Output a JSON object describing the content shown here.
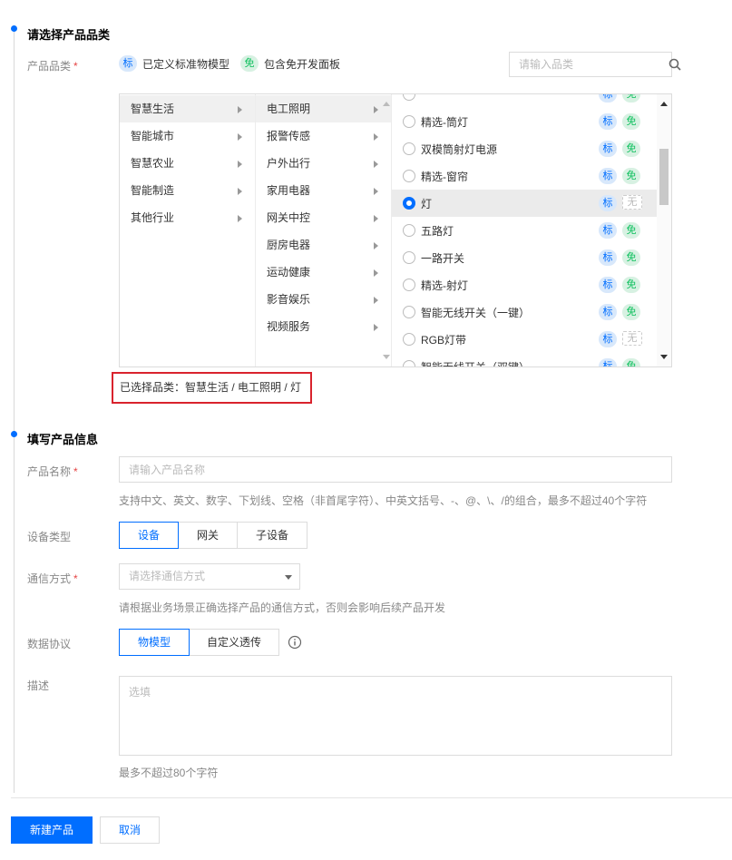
{
  "section1": {
    "title": "请选择产品品类"
  },
  "category": {
    "label": "产品品类",
    "required_mark": "*",
    "legend": {
      "biao_tag": "标",
      "biao_text": "已定义标准物模型",
      "mian_tag": "免",
      "mian_text": "包含免开发面板"
    },
    "search_placeholder": "请输入品类",
    "level1": [
      {
        "label": "智慧生活"
      },
      {
        "label": "智能城市"
      },
      {
        "label": "智慧农业"
      },
      {
        "label": "智能制造"
      },
      {
        "label": "其他行业"
      }
    ],
    "level2": [
      {
        "label": "电工照明"
      },
      {
        "label": "报警传感"
      },
      {
        "label": "户外出行"
      },
      {
        "label": "家用电器"
      },
      {
        "label": "网关中控"
      },
      {
        "label": "厨房电器"
      },
      {
        "label": "运动健康"
      },
      {
        "label": "影音娱乐"
      },
      {
        "label": "视频服务"
      }
    ],
    "level3": [
      {
        "label": "",
        "biao": "标",
        "mian": "免"
      },
      {
        "label": "精选-筒灯",
        "biao": "标",
        "mian": "免"
      },
      {
        "label": "双模筒射灯电源",
        "biao": "标",
        "mian": "免"
      },
      {
        "label": "精选-窗帘",
        "biao": "标",
        "mian": "免"
      },
      {
        "label": "灯",
        "biao": "标",
        "none": "无"
      },
      {
        "label": "五路灯",
        "biao": "标",
        "mian": "免"
      },
      {
        "label": "一路开关",
        "biao": "标",
        "mian": "免"
      },
      {
        "label": "精选-射灯",
        "biao": "标",
        "mian": "免"
      },
      {
        "label": "智能无线开关（一键）",
        "biao": "标",
        "mian": "免"
      },
      {
        "label": "RGB灯带",
        "biao": "标",
        "none": "无"
      },
      {
        "label": "智能无线开关（双键）",
        "biao": "标",
        "mian": "免"
      }
    ],
    "selected_path": "已选择品类：智慧生活 / 电工照明 / 灯"
  },
  "section2": {
    "title": "填写产品信息"
  },
  "product_name": {
    "label": "产品名称",
    "required_mark": "*",
    "placeholder": "请输入产品名称",
    "hint": "支持中文、英文、数字、下划线、空格（非首尾字符）、中英文括号、-、@、\\、/的组合，最多不超过40个字符"
  },
  "device_type": {
    "label": "设备类型",
    "options": [
      "设备",
      "网关",
      "子设备"
    ]
  },
  "comm": {
    "label": "通信方式",
    "required_mark": "*",
    "placeholder": "请选择通信方式",
    "hint": "请根据业务场景正确选择产品的通信方式，否则会影响后续产品开发"
  },
  "protocol": {
    "label": "数据协议",
    "options": [
      "物模型",
      "自定义透传"
    ]
  },
  "description": {
    "label": "描述",
    "placeholder": "选填",
    "hint": "最多不超过80个字符"
  },
  "actions": {
    "create": "新建产品",
    "cancel": "取消"
  },
  "colors": {
    "primary": "#006eff",
    "highlight_border": "#d9232d",
    "tag_biao_bg": "#d8e8fb",
    "tag_mian_bg": "#d7f1e2"
  }
}
